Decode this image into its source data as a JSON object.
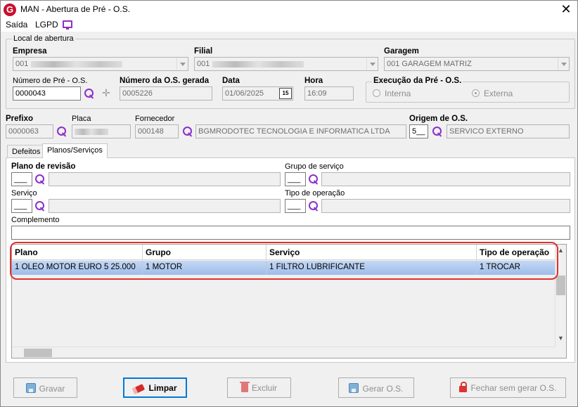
{
  "window": {
    "app_icon_letter": "G",
    "title": "MAN - Abertura de Pré - O.S.",
    "close_glyph": "✕"
  },
  "menu": {
    "items": [
      "Saída",
      "LGPD"
    ],
    "extra_icon": "monitor-icon"
  },
  "local_abertura": {
    "legend": "Local de abertura",
    "empresa_label": "Empresa",
    "empresa_value": "001",
    "filial_label": "Filial",
    "filial_value": "001",
    "garagem_label": "Garagem",
    "garagem_value": "001 GARAGEM MATRIZ",
    "numero_pre_os_label": "Número de Pré - O.S.",
    "numero_pre_os_value": "0000043",
    "numero_os_gerada_label": "Número da O.S. gerada",
    "numero_os_gerada_value": "0005226",
    "data_label": "Data",
    "data_value": "01/06/2025",
    "calendar_icon_text": "15",
    "hora_label": "Hora",
    "hora_value": "16:09",
    "execucao": {
      "legend": "Execução da Pré - O.S.",
      "options": [
        {
          "label": "Interna",
          "checked": false
        },
        {
          "label": "Externa",
          "checked": true
        }
      ]
    }
  },
  "veiculo": {
    "prefixo_label": "Prefixo",
    "prefixo_value": "0000063",
    "placa_label": "Placa",
    "placa_value": "",
    "fornecedor_label": "Fornecedor",
    "fornecedor_code": "000148",
    "fornecedor_name": "BGMRODOTEC TECNOLOGIA E INFORMATICA LTDA",
    "origem_label": "Origem de O.S.",
    "origem_code": "5__",
    "origem_desc": "SERVICO EXTERNO"
  },
  "tabs": [
    {
      "label": "Defeitos",
      "active": false
    },
    {
      "label": "Planos/Serviços",
      "active": true
    }
  ],
  "planos_servicos": {
    "plano_revisao_label": "Plano de revisão",
    "plano_revisao_code": "___",
    "grupo_servico_label": "Grupo de serviço",
    "grupo_servico_code": "___",
    "servico_label": "Serviço",
    "servico_code": "___",
    "tipo_operacao_label": "Tipo de operação",
    "tipo_operacao_code": "___",
    "complemento_label": "Complemento",
    "complemento_value": "",
    "grid": {
      "columns": [
        "Plano",
        "Grupo",
        "Serviço",
        "Tipo de operação"
      ],
      "rows": [
        [
          "1 OLEO MOTOR EURO 5 25.000",
          "1 MOTOR",
          "1 FILTRO LUBRIFICANTE",
          "1 TROCAR"
        ]
      ]
    }
  },
  "buttons": {
    "gravar": "Gravar",
    "limpar": "Limpar",
    "excluir": "Excluir",
    "gerar_os": "Gerar O.S.",
    "fechar_sem_gerar": "Fechar sem gerar O.S."
  },
  "colors": {
    "accent_purple": "#8b2fc9",
    "highlight_red": "#e0312e",
    "selected_row": "#9ebdea",
    "brand_red": "#c8102e"
  }
}
